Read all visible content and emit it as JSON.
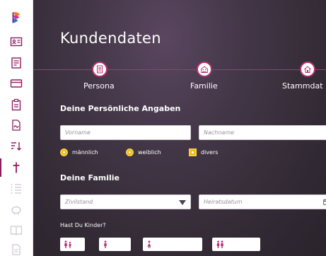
{
  "sidebar": {
    "items": [
      {
        "icon": "logo-icon"
      },
      {
        "icon": "id-card-icon"
      },
      {
        "icon": "document-icon"
      },
      {
        "icon": "credit-card-icon"
      },
      {
        "icon": "clipboard-icon"
      },
      {
        "icon": "signature-icon"
      },
      {
        "icon": "sort-icon"
      },
      {
        "icon": "cross-icon",
        "active": true
      },
      {
        "icon": "list-icon"
      },
      {
        "icon": "piggy-bank-icon"
      },
      {
        "icon": "book-icon"
      },
      {
        "icon": "file-icon"
      }
    ],
    "accent_color": "#8d1c5e"
  },
  "main": {
    "title": "Kundendaten",
    "steps": [
      {
        "label": "Persona",
        "icon": "persona-icon"
      },
      {
        "label": "Familie",
        "icon": "family-icon"
      },
      {
        "label": "Stammdat",
        "icon": "home-icon"
      }
    ],
    "personal": {
      "heading": "Deine Persönliche Angaben",
      "firstname_placeholder": "Vorname",
      "lastname_placeholder": "Nachname",
      "gender_options": [
        "männlich",
        "weiblich",
        "divers"
      ]
    },
    "family": {
      "heading": "Deine Familie",
      "civil_status_placeholder": "Zivilstand",
      "wedding_date_placeholder": "Heiratsdatum",
      "children_question": "Hast Du Kinder?"
    }
  },
  "colors": {
    "accent": "#b3306f",
    "radio": "#f2b705",
    "background": "#3a3040"
  }
}
